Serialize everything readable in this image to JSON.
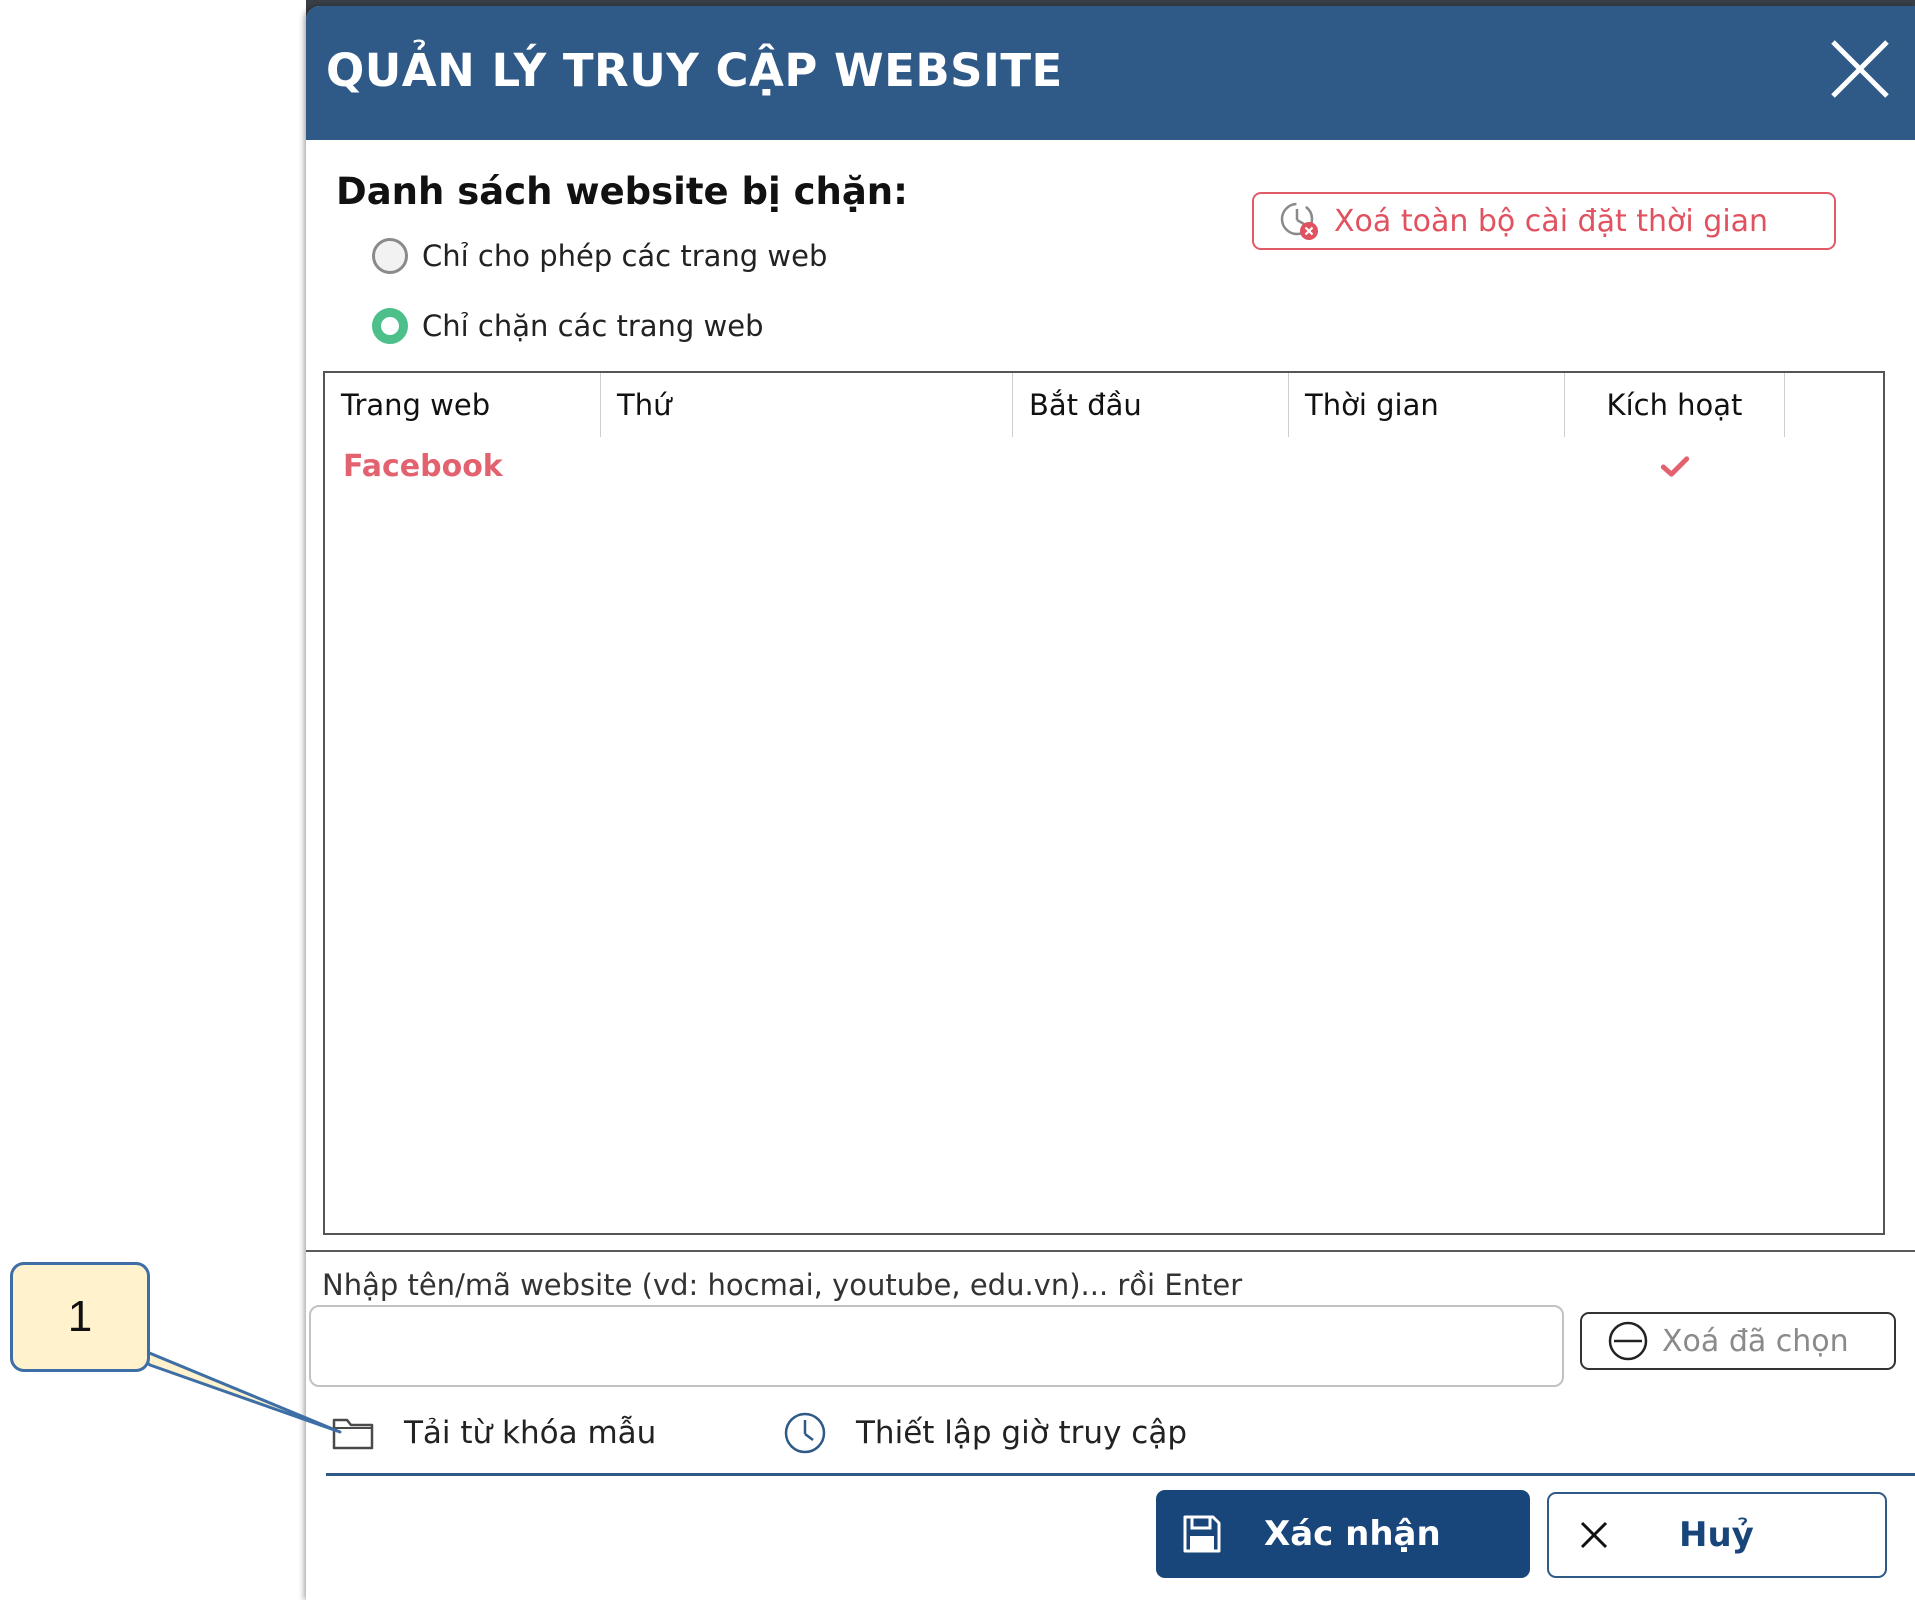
{
  "dialog": {
    "title": "QUẢN LÝ TRUY CẬP WEBSITE",
    "close_icon": "close-icon"
  },
  "blocked_list": {
    "label": "Danh sách website bị chặn:",
    "mode_options": [
      {
        "label": "Chỉ cho phép các trang web",
        "checked": false
      },
      {
        "label": "Chỉ chặn các trang web",
        "checked": true
      }
    ],
    "clear_time_button": {
      "label": "Xoá toàn bộ cài đặt thời gian",
      "icon": "clock-x-icon"
    }
  },
  "table": {
    "columns": [
      "Trang web",
      "Thứ",
      "Bắt đầu",
      "Thời gian",
      "Kích hoạt"
    ],
    "rows": [
      {
        "website": "Facebook",
        "days": "",
        "start": "",
        "duration": "",
        "active": true
      }
    ]
  },
  "input": {
    "hint": "Nhập tên/mã website (vd: hocmai, youtube, edu.vn)... rồi Enter",
    "value": "",
    "remove_selected_label": "Xoá đã chọn"
  },
  "links": {
    "load_keywords_label": "Tải từ khóa mẫu",
    "set_access_time_label": "Thiết lập giờ truy cập"
  },
  "footer": {
    "confirm_label": "Xác nhận",
    "cancel_label": "Huỷ"
  },
  "annotation": {
    "callout_number": "1"
  },
  "colors": {
    "titlebar": "#2f5987",
    "accent_red": "#e0525f",
    "radio_selected": "#4cbf8a",
    "confirm_bg": "#18457a",
    "callout_fill": "#fff2cc"
  }
}
